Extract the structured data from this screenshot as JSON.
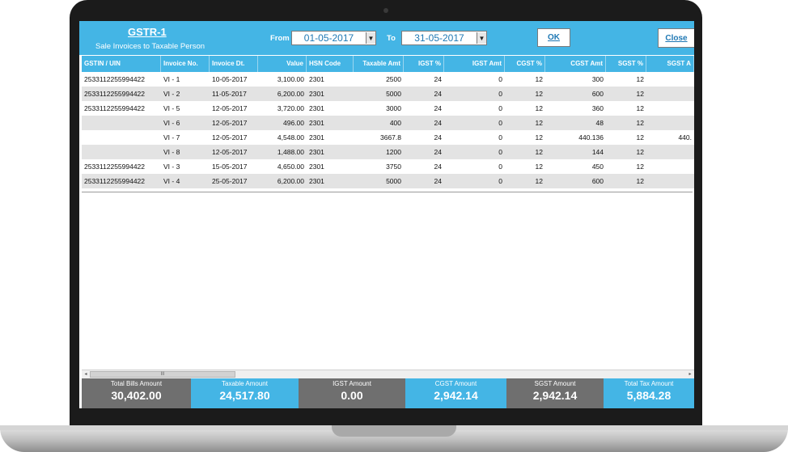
{
  "app": {
    "title": "GSTR-1",
    "subtitle": "Sale Invoices to Taxable Person"
  },
  "filters": {
    "from_label": "From",
    "from_value": "01-05-2017",
    "to_label": "To",
    "to_value": "31-05-2017",
    "ok_label": "OK",
    "close_label": "Close"
  },
  "table": {
    "columns": [
      "GSTIN / UIN",
      "Invoice No.",
      "Invoice Dt.",
      "Value",
      "HSN Code",
      "Taxable Amt",
      "IGST %",
      "IGST Amt",
      "CGST %",
      "CGST Amt",
      "SGST %",
      "SGST A"
    ],
    "rows": [
      [
        "2533112255994422",
        "VI - 1",
        "10-05-2017",
        "3,100.00",
        "2301",
        "2500",
        "24",
        "0",
        "12",
        "300",
        "12",
        ""
      ],
      [
        "2533112255994422",
        "VI - 2",
        "11-05-2017",
        "6,200.00",
        "2301",
        "5000",
        "24",
        "0",
        "12",
        "600",
        "12",
        ""
      ],
      [
        "2533112255994422",
        "VI - 5",
        "12-05-2017",
        "3,720.00",
        "2301",
        "3000",
        "24",
        "0",
        "12",
        "360",
        "12",
        ""
      ],
      [
        "",
        "VI - 6",
        "12-05-2017",
        "496.00",
        "2301",
        "400",
        "24",
        "0",
        "12",
        "48",
        "12",
        ""
      ],
      [
        "",
        "VI - 7",
        "12-05-2017",
        "4,548.00",
        "2301",
        "3667.8",
        "24",
        "0",
        "12",
        "440.136",
        "12",
        "440."
      ],
      [
        "",
        "VI - 8",
        "12-05-2017",
        "1,488.00",
        "2301",
        "1200",
        "24",
        "0",
        "12",
        "144",
        "12",
        ""
      ],
      [
        "2533112255994422",
        "VI - 3",
        "15-05-2017",
        "4,650.00",
        "2301",
        "3750",
        "24",
        "0",
        "12",
        "450",
        "12",
        ""
      ],
      [
        "2533112255994422",
        "VI - 4",
        "25-05-2017",
        "6,200.00",
        "2301",
        "5000",
        "24",
        "0",
        "12",
        "600",
        "12",
        ""
      ]
    ]
  },
  "scrollbar": {
    "thumb_glyph": "III",
    "left_arrow": "◂",
    "right_arrow": "▸"
  },
  "summary": [
    {
      "label": "Total Bills Amount",
      "value": "30,402.00",
      "color": "#6f6f6f"
    },
    {
      "label": "Taxable Amount",
      "value": "24,517.80",
      "color": "#44b5e5"
    },
    {
      "label": "IGST Amount",
      "value": "0.00",
      "color": "#6f6f6f"
    },
    {
      "label": "CGST Amount",
      "value": "2,942.14",
      "color": "#44b5e5"
    },
    {
      "label": "SGST Amount",
      "value": "2,942.14",
      "color": "#6f6f6f"
    },
    {
      "label": "Total Tax Amount",
      "value": "5,884.28",
      "color": "#44b5e5"
    }
  ],
  "colors": {
    "accent": "#44b5e5",
    "summary_gray": "#6f6f6f",
    "date_text": "#1f78b4"
  }
}
